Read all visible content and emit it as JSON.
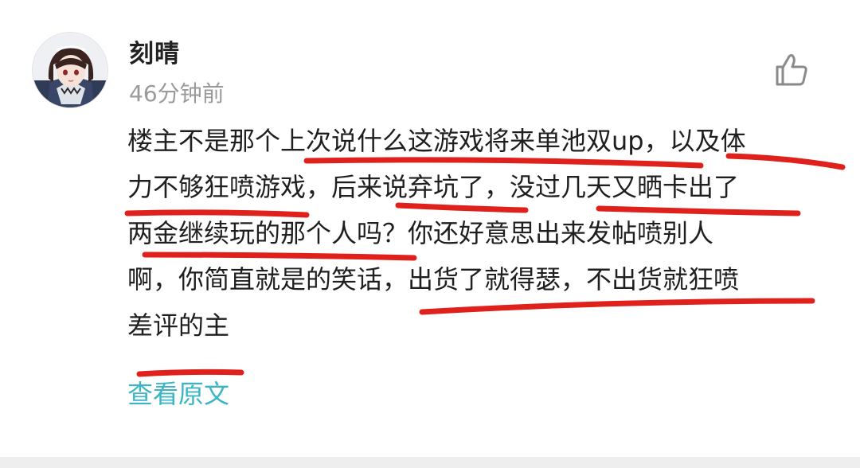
{
  "comment": {
    "username": "刻晴",
    "time": "46分钟前",
    "lines": [
      "楼主不是那个上次说什么这游戏将来单池双up，以及体",
      "力不够狂喷游戏，后来说弃坑了，没过几天又晒卡出了",
      "两金继续玩的那个人吗？你还好意思出来发帖喷别人",
      "啊，你简直就是的笑话，出货了就得瑟，不出货就狂喷",
      "差评的主"
    ],
    "view_original_label": "查看原文"
  },
  "icons": {
    "like": "thumbs-up-icon",
    "avatar": "anime-avatar"
  },
  "colors": {
    "link": "#3bb5c4",
    "annotation": "#e0201b",
    "muted": "#9a9a9a"
  }
}
